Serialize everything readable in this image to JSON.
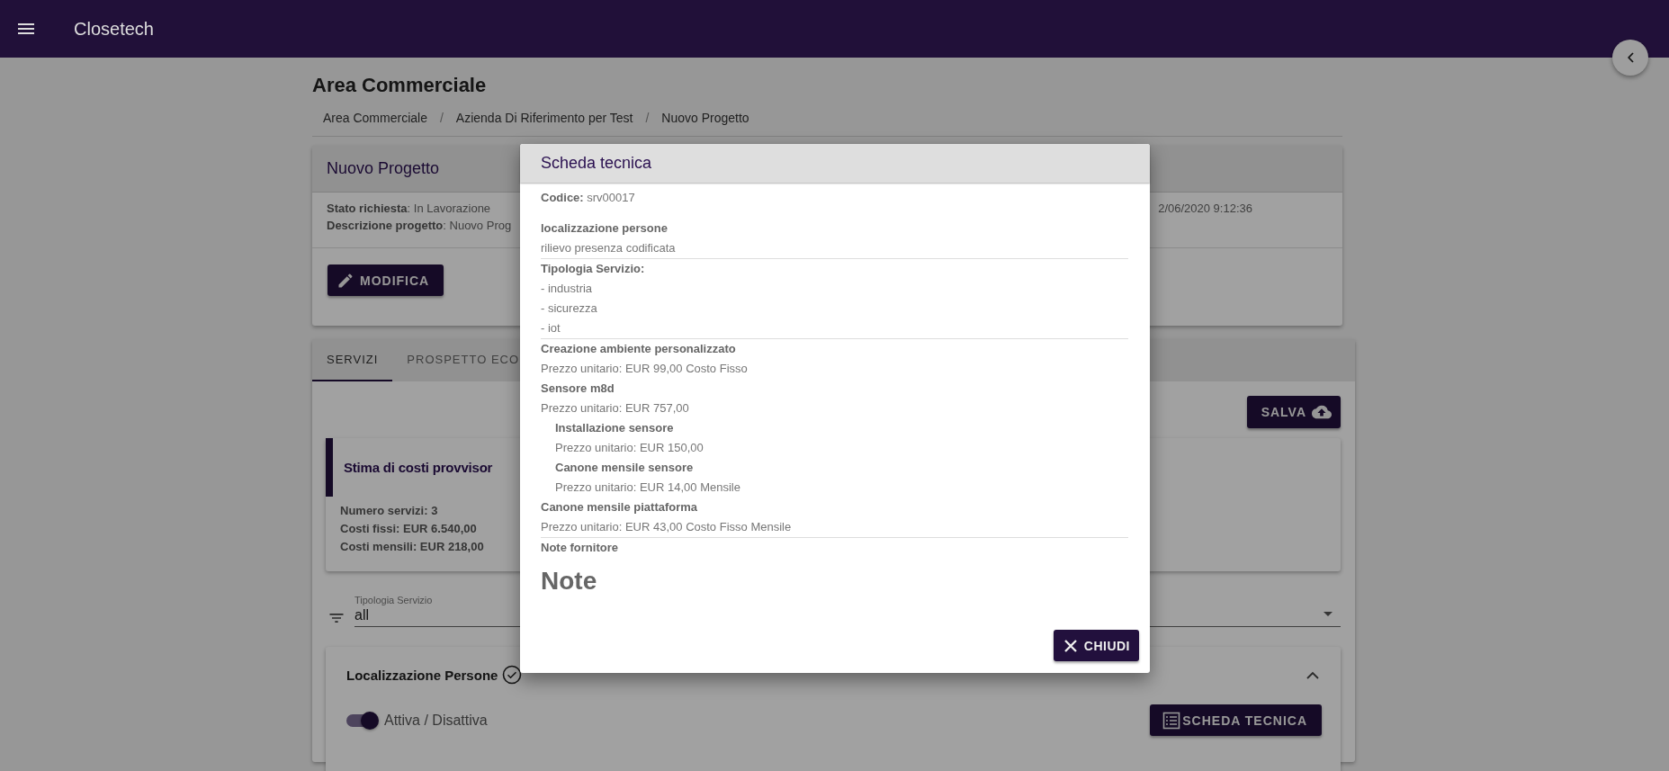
{
  "app_bar": {
    "title": "Closetech"
  },
  "page": {
    "title": "Area Commerciale",
    "breadcrumbs": [
      {
        "kind": "link",
        "text": "Area Commerciale"
      },
      {
        "kind": "separator",
        "text": "/"
      },
      {
        "kind": "link",
        "text": "Azienda Di Riferimento per Test"
      },
      {
        "kind": "separator",
        "text": "/"
      },
      {
        "kind": "link",
        "text": "Nuovo Progetto"
      }
    ]
  },
  "project_card": {
    "title": "Nuovo Progetto",
    "fields": [
      "**Stato richiesta**: In Lavorazione",
      "**Descrizione progetto**: Nuovo Prog"
    ],
    "date_text": "2/06/2020 9:12:36",
    "edit_button": "MODIFICA"
  },
  "tabs": [
    {
      "label": "SERVIZI",
      "selected": true
    },
    {
      "label": "PROSPETTO ECO",
      "selected": false
    }
  ],
  "save_button": "SALVA",
  "estimate_card": {
    "title": "Stima di costi provvisor",
    "lines": [
      "Numero servizi: 3",
      "Costi fissi: EUR 6.540,00",
      "Costi mensili: EUR 218,00"
    ]
  },
  "filter": {
    "label": "Tipologia Servizio",
    "value": "all"
  },
  "service_panel": {
    "title": "Localizzazione Persone",
    "expanded": true,
    "toggle": {
      "label": "Attiva / Disattiva",
      "on": true
    },
    "sheet_button": "SCHEDA TECNICA"
  },
  "dialog": {
    "title": "Scheda tecnica",
    "code": "**Codice:** srv00017",
    "blocks": [
      {
        "items": [
          {
            "name": "localizzazione persone",
            "details": [
              "rilievo presenza codificata"
            ]
          }
        ]
      },
      {
        "items": [
          {
            "name": "Tipologia Servizio:",
            "details": [
              "- industria",
              "- sicurezza",
              "- iot"
            ]
          }
        ]
      },
      {
        "items": [
          {
            "name": "Creazione ambiente personalizzato",
            "details": [
              "Prezzo unitario: EUR 99,00 Costo Fisso"
            ]
          },
          {
            "name": "Sensore m8d",
            "details": [
              "Prezzo unitario: EUR 757,00"
            ],
            "children": [
              {
                "name": "Installazione sensore",
                "details": [
                  "Prezzo unitario: EUR 150,00"
                ]
              },
              {
                "name": "Canone mensile sensore",
                "details": [
                  "Prezzo unitario: EUR 14,00 Mensile"
                ]
              }
            ]
          },
          {
            "name": "Canone mensile piattaforma",
            "details": [
              "Prezzo unitario: EUR 43,00 Costo Fisso Mensile"
            ]
          }
        ]
      },
      {
        "items": [
          {
            "name": "Note fornitore"
          }
        ]
      }
    ],
    "notes": "Note",
    "close_button": "CHIUDI"
  }
}
